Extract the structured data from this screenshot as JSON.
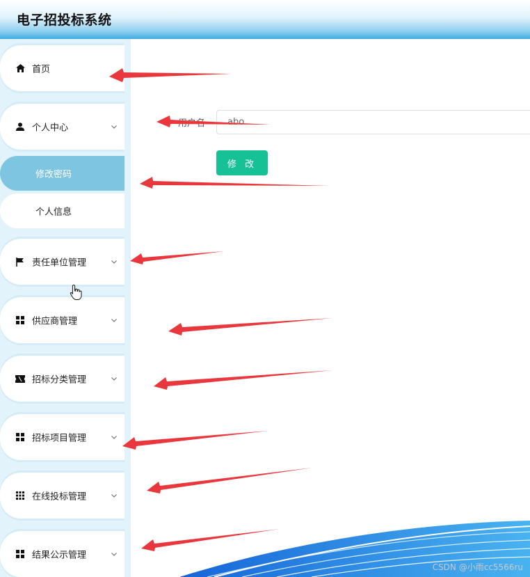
{
  "header": {
    "title": "电子招投标系统"
  },
  "sidebar": {
    "items": [
      {
        "label": "首页",
        "icon": "home-icon",
        "expandable": false
      },
      {
        "label": "个人中心",
        "icon": "user-icon",
        "expandable": true
      },
      {
        "label": "责任单位管理",
        "icon": "flag-icon",
        "expandable": true
      },
      {
        "label": "供应商管理",
        "icon": "grid-icon",
        "expandable": true
      },
      {
        "label": "招标分类管理",
        "icon": "ticket-icon",
        "expandable": true
      },
      {
        "label": "招标项目管理",
        "icon": "grid-icon",
        "expandable": true
      },
      {
        "label": "在线投标管理",
        "icon": "apps-icon",
        "expandable": true
      },
      {
        "label": "结果公示管理",
        "icon": "grid-icon",
        "expandable": true
      }
    ],
    "submenu": [
      {
        "label": "修改密码",
        "active": true
      },
      {
        "label": "个人信息",
        "active": false
      }
    ]
  },
  "form": {
    "username_label": "用户名",
    "username_value": "abo",
    "submit_label": "修 改"
  },
  "watermark": "CSDN @小雨cc5566ru",
  "colors": {
    "accent": "#17c196",
    "active_menu": "#7ec5e1",
    "sidebar_bg": "#e3f3fb",
    "arrow": "#e8383d"
  }
}
